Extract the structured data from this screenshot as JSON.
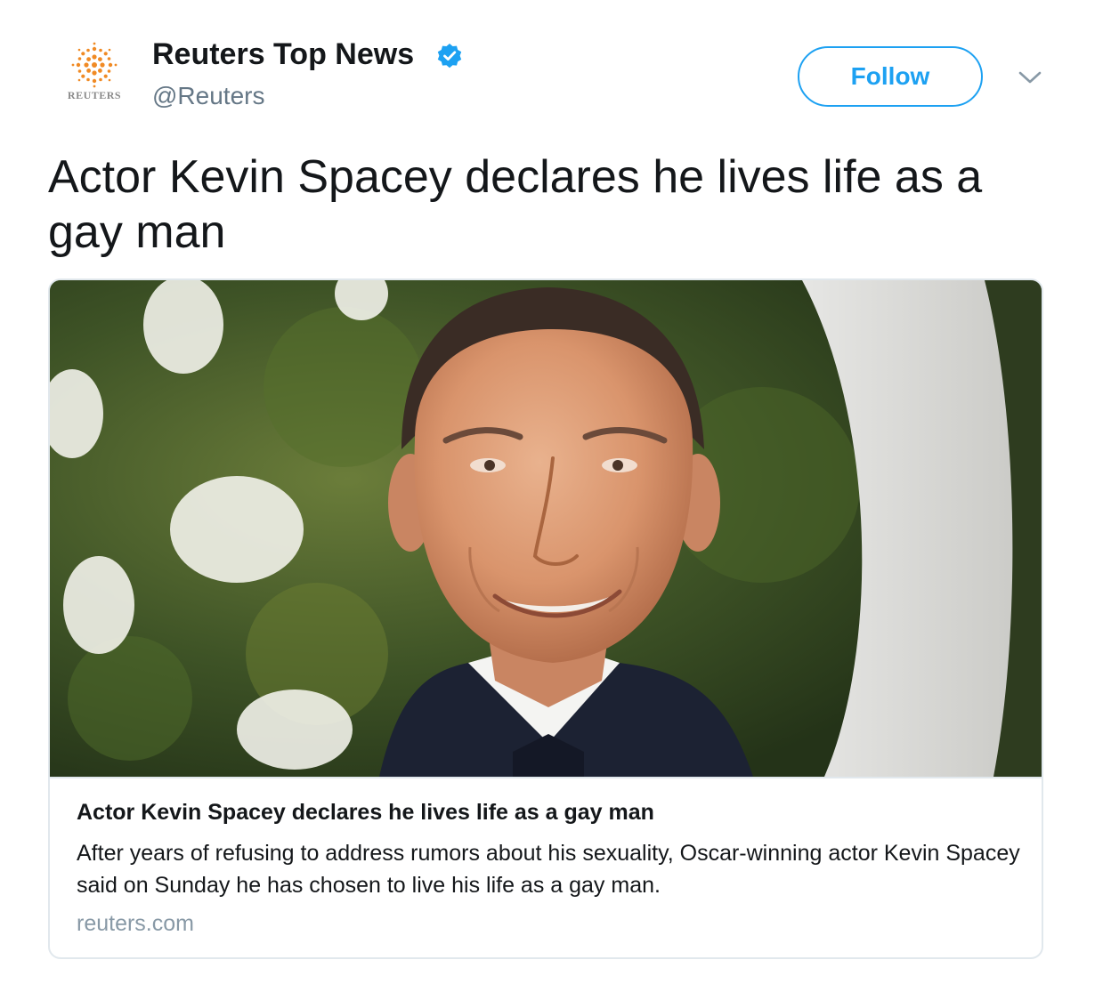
{
  "author": {
    "display_name": "Reuters Top News",
    "handle": "@Reuters",
    "avatar_label": "REUTERS",
    "verified": true
  },
  "actions": {
    "follow_label": "Follow"
  },
  "tweet": {
    "text": "Actor Kevin Spacey declares he lives life as a gay man"
  },
  "card": {
    "title": "Actor Kevin Spacey declares he lives life as a gay man",
    "description": "After years of refusing to address rumors about his sexuality, Oscar-winning actor Kevin Spacey said on Sunday he has chosen to live his life as a gay man.",
    "domain": "reuters.com"
  },
  "colors": {
    "accent": "#1da1f2",
    "brand_orange": "#f08a24",
    "text_primary": "#14171a",
    "text_secondary": "#657786",
    "border": "#e1e8ed"
  }
}
